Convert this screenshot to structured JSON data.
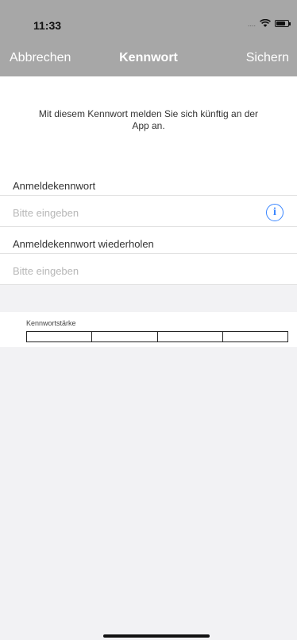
{
  "status_bar": {
    "time": "11:33",
    "signal": "....",
    "wifi_icon": "wifi-icon",
    "battery_icon": "battery-icon"
  },
  "nav": {
    "cancel_label": "Abbrechen",
    "title": "Kennwort",
    "save_label": "Sichern"
  },
  "info": {
    "text": "Mit diesem Kennwort melden Sie sich künftig an der App an."
  },
  "form": {
    "password_label": "Anmeldekennwort",
    "password_placeholder": "Bitte eingeben",
    "info_icon_glyph": "i",
    "repeat_label": "Anmeldekennwort wiederholen",
    "repeat_placeholder": "Bitte eingeben"
  },
  "strength": {
    "label": "Kennwortstärke",
    "segments": 4,
    "level": 0
  },
  "colors": {
    "header_bg": "#a7a7a7",
    "accent": "#3a86ff",
    "page_bg": "#f2f2f4"
  }
}
